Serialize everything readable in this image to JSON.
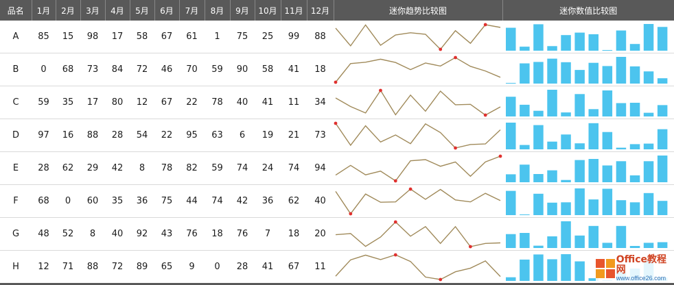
{
  "header": {
    "name_col": "品名",
    "months": [
      "1月",
      "2月",
      "3月",
      "4月",
      "5月",
      "6月",
      "7月",
      "8月",
      "9月",
      "10月",
      "11月",
      "12月"
    ],
    "trend_col": "迷你趋势比较图",
    "value_col": "迷你数值比较图"
  },
  "rows": [
    {
      "name": "A",
      "values": [
        85,
        15,
        98,
        17,
        58,
        67,
        61,
        1,
        75,
        25,
        99,
        88
      ]
    },
    {
      "name": "B",
      "values": [
        0,
        68,
        73,
        84,
        72,
        46,
        70,
        59,
        90,
        58,
        41,
        18
      ]
    },
    {
      "name": "C",
      "values": [
        59,
        35,
        17,
        80,
        12,
        67,
        22,
        78,
        40,
        41,
        11,
        34
      ]
    },
    {
      "name": "D",
      "values": [
        97,
        16,
        88,
        28,
        54,
        22,
        95,
        63,
        6,
        19,
        21,
        73
      ]
    },
    {
      "name": "E",
      "values": [
        28,
        62,
        29,
        42,
        8,
        78,
        82,
        59,
        74,
        24,
        74,
        94
      ]
    },
    {
      "name": "F",
      "values": [
        68,
        0,
        60,
        35,
        36,
        75,
        44,
        74,
        42,
        36,
        62,
        40
      ]
    },
    {
      "name": "G",
      "values": [
        48,
        52,
        8,
        40,
        92,
        43,
        76,
        18,
        76,
        7,
        18,
        20
      ]
    },
    {
      "name": "H",
      "values": [
        12,
        71,
        88,
        72,
        89,
        65,
        9,
        0,
        28,
        41,
        67,
        11
      ]
    }
  ],
  "chart_data": [
    {
      "type": "line",
      "title": "迷你趋势比较图",
      "categories": [
        "1月",
        "2月",
        "3月",
        "4月",
        "5月",
        "6月",
        "7月",
        "8月",
        "9月",
        "10月",
        "11月",
        "12月"
      ],
      "series": [
        {
          "name": "A",
          "values": [
            85,
            15,
            98,
            17,
            58,
            67,
            61,
            1,
            75,
            25,
            99,
            88
          ]
        },
        {
          "name": "B",
          "values": [
            0,
            68,
            73,
            84,
            72,
            46,
            70,
            59,
            90,
            58,
            41,
            18
          ]
        },
        {
          "name": "C",
          "values": [
            59,
            35,
            17,
            80,
            12,
            67,
            22,
            78,
            40,
            41,
            11,
            34
          ]
        },
        {
          "name": "D",
          "values": [
            97,
            16,
            88,
            28,
            54,
            22,
            95,
            63,
            6,
            19,
            21,
            73
          ]
        },
        {
          "name": "E",
          "values": [
            28,
            62,
            29,
            42,
            8,
            78,
            82,
            59,
            74,
            24,
            74,
            94
          ]
        },
        {
          "name": "F",
          "values": [
            68,
            0,
            60,
            35,
            36,
            75,
            44,
            74,
            42,
            36,
            62,
            40
          ]
        },
        {
          "name": "G",
          "values": [
            48,
            52,
            8,
            40,
            92,
            43,
            76,
            18,
            76,
            7,
            18,
            20
          ]
        },
        {
          "name": "H",
          "values": [
            12,
            71,
            88,
            72,
            89,
            65,
            9,
            0,
            28,
            41,
            67,
            11
          ]
        }
      ],
      "markers": "high and low points marked"
    },
    {
      "type": "bar",
      "title": "迷你数值比较图",
      "categories": [
        "1月",
        "2月",
        "3月",
        "4月",
        "5月",
        "6月",
        "7月",
        "8月",
        "9月",
        "10月",
        "11月",
        "12月"
      ],
      "series": [
        {
          "name": "A",
          "values": [
            85,
            15,
            98,
            17,
            58,
            67,
            61,
            1,
            75,
            25,
            99,
            88
          ]
        },
        {
          "name": "B",
          "values": [
            0,
            68,
            73,
            84,
            72,
            46,
            70,
            59,
            90,
            58,
            41,
            18
          ]
        },
        {
          "name": "C",
          "values": [
            59,
            35,
            17,
            80,
            12,
            67,
            22,
            78,
            40,
            41,
            11,
            34
          ]
        },
        {
          "name": "D",
          "values": [
            97,
            16,
            88,
            28,
            54,
            22,
            95,
            63,
            6,
            19,
            21,
            73
          ]
        },
        {
          "name": "E",
          "values": [
            28,
            62,
            29,
            42,
            8,
            78,
            82,
            59,
            74,
            24,
            74,
            94
          ]
        },
        {
          "name": "F",
          "values": [
            68,
            0,
            60,
            35,
            36,
            75,
            44,
            74,
            42,
            36,
            62,
            40
          ]
        },
        {
          "name": "G",
          "values": [
            48,
            52,
            8,
            40,
            92,
            43,
            76,
            18,
            76,
            7,
            18,
            20
          ]
        },
        {
          "name": "H",
          "values": [
            12,
            71,
            88,
            72,
            89,
            65,
            9,
            0,
            28,
            41,
            67,
            11
          ]
        }
      ]
    }
  ],
  "colors": {
    "header_bg": "#595959",
    "line": "#a08a5a",
    "marker": "#e0312f",
    "bar": "#4cc4ee"
  },
  "watermark": {
    "name": "Office教程网",
    "url": "www.office26.com"
  }
}
